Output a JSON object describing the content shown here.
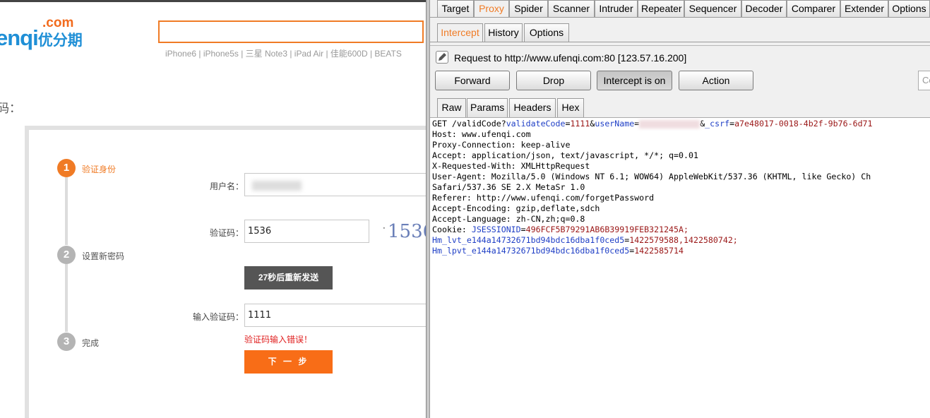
{
  "site": {
    "logo": {
      "com": ".com",
      "brand": "enqi",
      "brand_cn": "优分期"
    },
    "hot_searches": "iPhone6 | iPhone5s | 三星 Note3 | iPad Air | 佳能600D | BEATS",
    "page_heading": "码：",
    "steps": [
      {
        "num": "1",
        "label": "验证身份"
      },
      {
        "num": "2",
        "label": "设置新密码"
      },
      {
        "num": "3",
        "label": "完成"
      }
    ],
    "form": {
      "username_label": "用户名：",
      "captcha_label": "验证码：",
      "captcha_value": "1536",
      "captcha_image_text": "1536",
      "resend_button": "27秒后重新发送",
      "sms_label": "输入验证码：",
      "sms_value": "1111",
      "error": "验证码输入错误！",
      "next_button": "下 一 步"
    }
  },
  "burp": {
    "main_tabs": [
      "Target",
      "Proxy",
      "Spider",
      "Scanner",
      "Intruder",
      "Repeater",
      "Sequencer",
      "Decoder",
      "Comparer",
      "Extender",
      "Options"
    ],
    "active_main_tab": "Proxy",
    "proxy_tabs": [
      "Intercept",
      "History",
      "Options"
    ],
    "active_proxy_tab": "Intercept",
    "request_line": "Request to http://www.ufenqi.com:80  [123.57.16.200]",
    "buttons": {
      "forward": "Forward",
      "drop": "Drop",
      "intercept": "Intercept is on",
      "action": "Action"
    },
    "search_placeholder": "Co",
    "view_tabs": [
      "Raw",
      "Params",
      "Headers",
      "Hex"
    ],
    "active_view_tab": "Raw",
    "request": {
      "line1_prefix": "GET /validCode?",
      "line1_k1": "validateCode",
      "line1_v1": "1111",
      "line1_k2": "userName",
      "line1_k3": "_csrf",
      "line1_v3": "a7e48017-0018-4b2f-9b76-6d71",
      "headers": [
        "Host: www.ufenqi.com",
        "Proxy-Connection: keep-alive",
        "Accept: application/json, text/javascript, */*; q=0.01",
        "X-Requested-With: XMLHttpRequest",
        "User-Agent: Mozilla/5.0 (Windows NT 6.1; WOW64) AppleWebKit/537.36 (KHTML, like Gecko) Ch",
        "Safari/537.36 SE 2.X MetaSr 1.0",
        "Referer: http://www.ufenqi.com/forgetPassword",
        "Accept-Encoding: gzip,deflate,sdch",
        "Accept-Language: zh-CN,zh;q=0.8"
      ],
      "cookie_label": "Cookie: ",
      "cookies": [
        {
          "k": "JSESSIONID",
          "v": "496FCF5B79291AB6B39919FEB321245A;"
        },
        {
          "k": "Hm_lvt_e144a14732671bd94bdc16dba1f0ced5",
          "v": "1422579588,1422580742;"
        },
        {
          "k": "Hm_lpvt_e144a14732671bd94bdc16dba1f0ced5",
          "v": "1422585714"
        }
      ]
    }
  }
}
